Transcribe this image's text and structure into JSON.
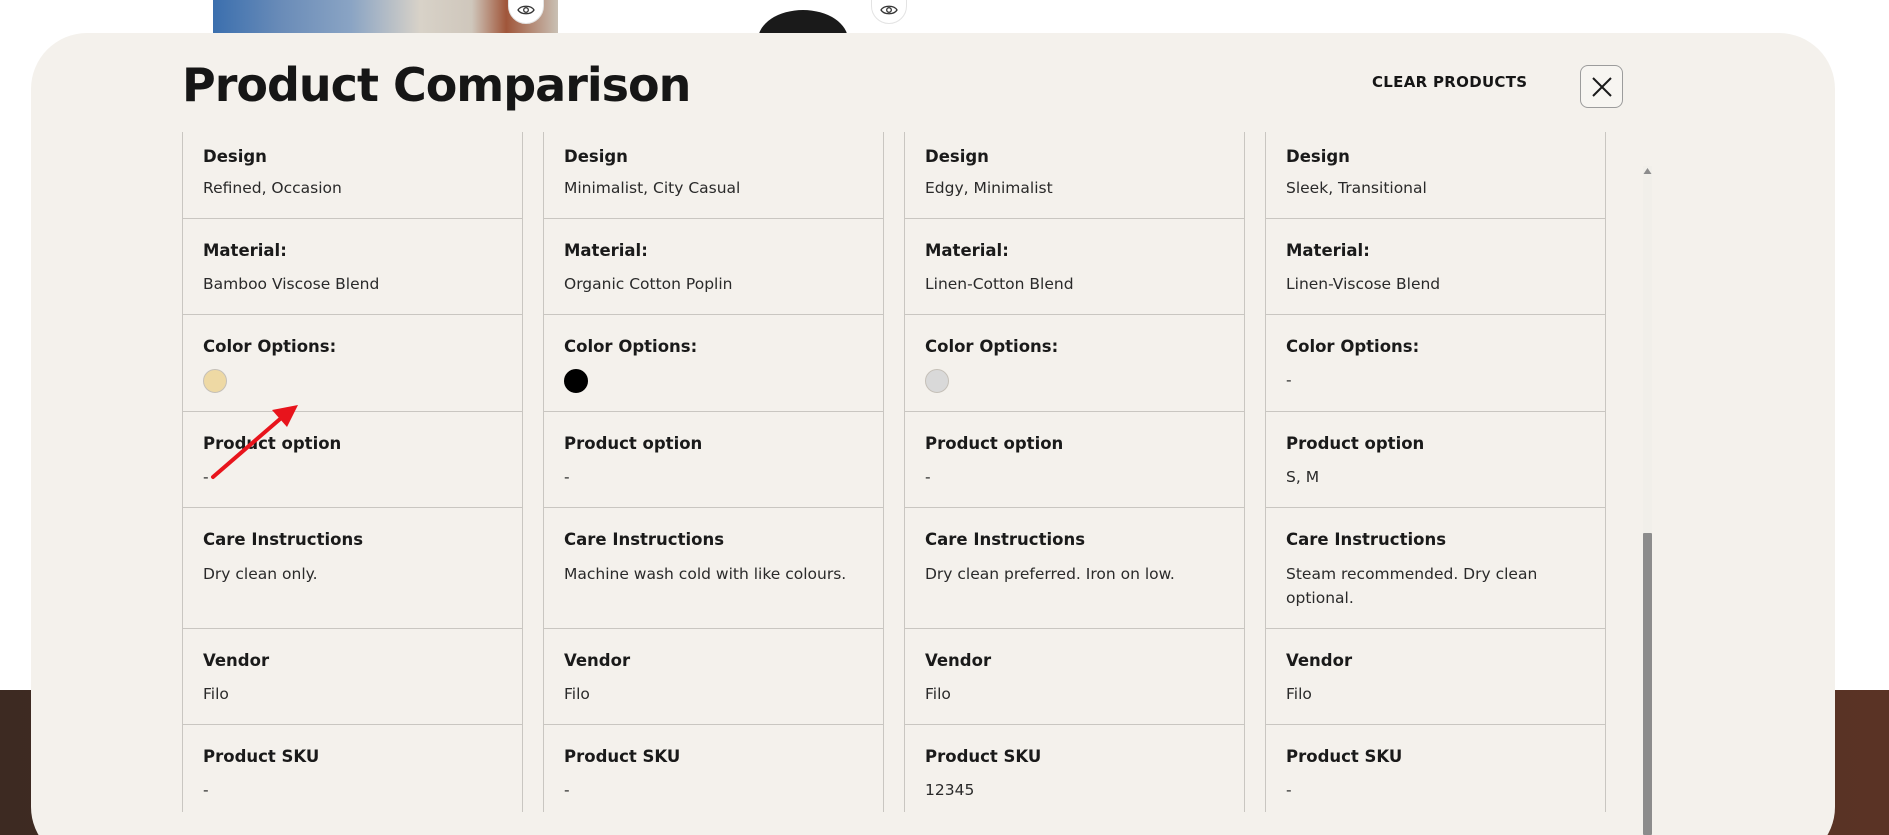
{
  "modal": {
    "title": "Product Comparison",
    "clear_label": "CLEAR PRODUCTS"
  },
  "columns": [
    {
      "design_label": "Design",
      "design": "Refined, Occasion",
      "material_label": "Material:",
      "material": "Bamboo Viscose Blend",
      "color_label": "Color Options:",
      "color_swatch": "#eed9a4",
      "option_label": "Product option",
      "option": "-",
      "care_label": "Care Instructions",
      "care": "Dry clean only.",
      "vendor_label": "Vendor",
      "vendor": "Filo",
      "sku_label": "Product SKU",
      "sku": "-"
    },
    {
      "design_label": "Design",
      "design": "Minimalist, City Casual",
      "material_label": "Material:",
      "material": "Organic Cotton Poplin",
      "color_label": "Color Options:",
      "color_swatch": "#000000",
      "option_label": "Product option",
      "option": "-",
      "care_label": "Care Instructions",
      "care": "Machine wash cold with like colours.",
      "vendor_label": "Vendor",
      "vendor": "Filo",
      "sku_label": "Product SKU",
      "sku": "-"
    },
    {
      "design_label": "Design",
      "design": "Edgy, Minimalist",
      "material_label": "Material:",
      "material": "Linen-Cotton Blend",
      "color_label": "Color Options:",
      "color_swatch": "#d9d9d9",
      "option_label": "Product option",
      "option": "-",
      "care_label": "Care Instructions",
      "care": "Dry clean preferred. Iron on low.",
      "vendor_label": "Vendor",
      "vendor": "Filo",
      "sku_label": "Product SKU",
      "sku": "12345"
    },
    {
      "design_label": "Design",
      "design": "Sleek, Transitional",
      "material_label": "Material:",
      "material": "Linen-Viscose Blend",
      "color_label": "Color Options:",
      "color_value": "-",
      "option_label": "Product option",
      "option": "S, M",
      "care_label": "Care Instructions",
      "care": "Steam recommended. Dry clean optional.",
      "vendor_label": "Vendor",
      "vendor": "Filo",
      "sku_label": "Product SKU",
      "sku": "-"
    }
  ],
  "colors": {
    "modal_bg": "#f4f1ec",
    "annotation": "#e8141c"
  }
}
